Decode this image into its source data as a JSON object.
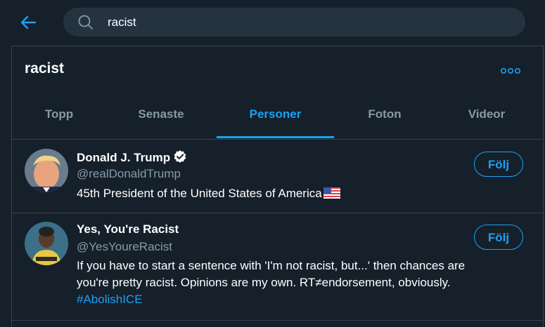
{
  "search": {
    "query": "racist"
  },
  "header": {
    "title": "racist"
  },
  "tabs": [
    {
      "label": "Topp"
    },
    {
      "label": "Senaste"
    },
    {
      "label": "Personer"
    },
    {
      "label": "Foton"
    },
    {
      "label": "Videor"
    }
  ],
  "active_tab": "Personer",
  "users": [
    {
      "name": "Donald J. Trump",
      "handle": "@realDonaldTrump",
      "verified": true,
      "bio": "45th President of the United States of America",
      "bio_emoji": "us-flag",
      "follow_label": "Följ"
    },
    {
      "name": "Yes, You're Racist",
      "handle": "@YesYoureRacist",
      "verified": false,
      "bio_line1": "If you have to start a sentence with 'I'm not racist, but...' then chances are",
      "bio_line2": "you're pretty racist. Opinions are my own. RT≠endorsement, obviously.",
      "bio_hashtag": "#AbolishICE",
      "follow_label": "Följ"
    }
  ],
  "colors": {
    "background": "#15202b",
    "accent": "#1da1f2",
    "muted": "#8899a6",
    "border": "#38444d"
  }
}
